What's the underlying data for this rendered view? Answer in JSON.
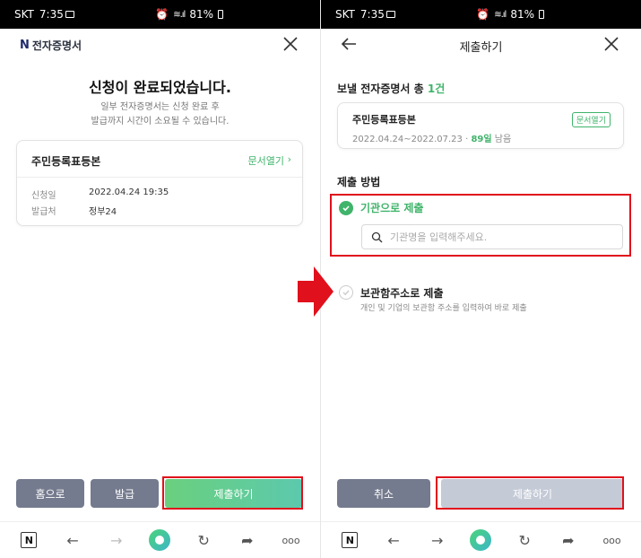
{
  "status_bar": {
    "carrier": "SKT",
    "time": "7:35",
    "battery": "81%"
  },
  "left": {
    "brand_mark": "N",
    "brand_name": "전자증명서",
    "title": "신청이 완료되었습니다.",
    "subtitle_line1": "일부 전자증명서는 신청 완료 후",
    "subtitle_line2": "발급까지 시간이 소요될 수 있습니다.",
    "card": {
      "doc_title": "주민등록표등본",
      "open_link": "문서열기",
      "rows": [
        {
          "label": "신청일",
          "value": "2022.04.24 19:35"
        },
        {
          "label": "발급처",
          "value": "정부24"
        }
      ]
    },
    "buttons": {
      "home": "홈으로",
      "issue": "발급",
      "submit": "제출하기"
    }
  },
  "right": {
    "header_title": "제출하기",
    "send_count_label": "보낼 전자증명서 총",
    "send_count": "1건",
    "card": {
      "doc_title": "주민등록표등본",
      "open_link": "문서열기",
      "period": "2022.04.24~2022.07.23 · ",
      "days": "89일",
      "days_suffix": " 남음"
    },
    "method_heading": "제출 방법",
    "option1": {
      "label": "기관으로 제출",
      "search_placeholder": "기관명을 입력해주세요."
    },
    "option2": {
      "label": "보관함주소로 제출",
      "description": "개인 및 기업의 보관함 주소를 입력하여 바로 제출"
    },
    "buttons": {
      "cancel": "취소",
      "submit": "제출하기"
    }
  },
  "nav_bar": {
    "n_button": "N",
    "more": "ooo"
  },
  "colors": {
    "accent_green": "#3fb46a",
    "highlight_red": "#e0101c",
    "button_gray": "#757b8e",
    "disabled_gray": "#c4cad6"
  }
}
